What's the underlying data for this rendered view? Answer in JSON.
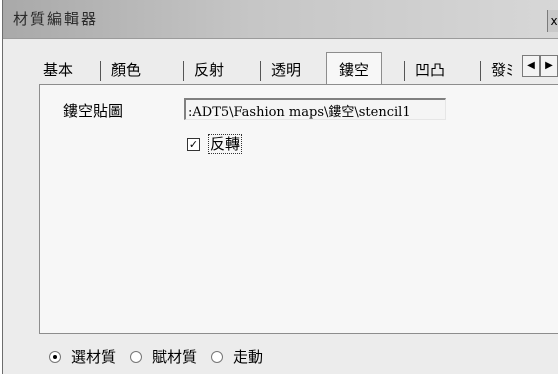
{
  "window": {
    "title": "材質編輯器",
    "close_glyph": "x"
  },
  "tabs": [
    {
      "label": "基本",
      "active": false
    },
    {
      "label": "顏色",
      "active": false
    },
    {
      "label": "反射",
      "active": false
    },
    {
      "label": "透明",
      "active": false
    },
    {
      "label": "鏤空",
      "active": true
    },
    {
      "label": "凹凸",
      "active": false
    },
    {
      "label": "發ﾐ",
      "active": false
    }
  ],
  "tab_scroll": {
    "left_glyph": "◀",
    "right_glyph": "▶"
  },
  "stencil": {
    "label": "鏤空貼圖",
    "path_value": ":ADT5\\Fashion maps\\鏤空\\stencil1",
    "invert_label": "反轉",
    "invert_checked": true,
    "check_glyph": "✓"
  },
  "mode_options": [
    {
      "label": "選材質",
      "checked": true
    },
    {
      "label": "賦材質",
      "checked": false
    },
    {
      "label": "走動",
      "checked": false
    }
  ]
}
